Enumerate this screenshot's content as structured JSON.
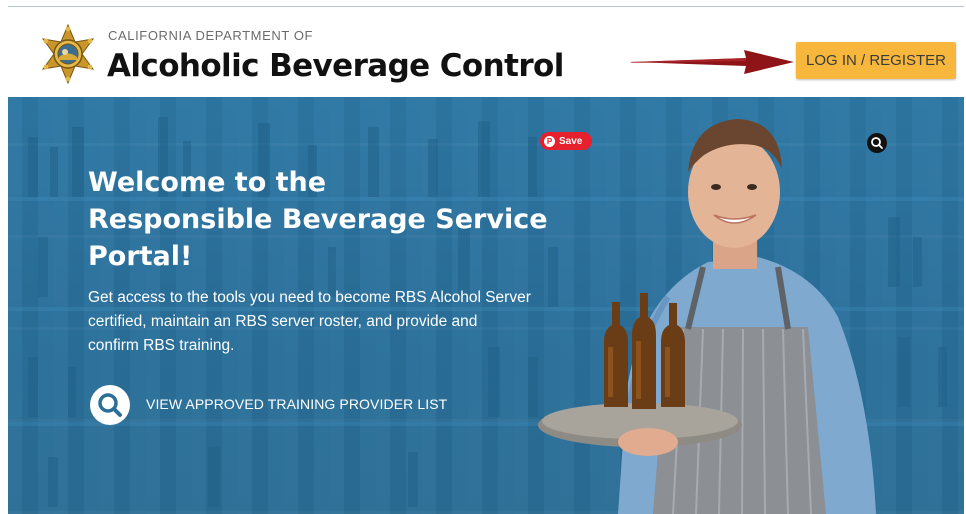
{
  "header": {
    "department": "CALIFORNIA DEPARTMENT OF",
    "brand": "Alcoholic Beverage Control",
    "login_label": "LOG IN / REGISTER"
  },
  "hero": {
    "title_lines": [
      "Welcome to the",
      "Responsible Beverage Service",
      "Portal!"
    ],
    "description_lines": [
      "Get access to the tools you need to become RBS Alcohol Server",
      "certified, maintain an RBS server roster, and provide and",
      "confirm RBS training."
    ],
    "view_link": "VIEW APPROVED TRAINING PROVIDER LIST"
  },
  "overlays": {
    "pinterest_label": "Save"
  },
  "colors": {
    "hero_blue": "#2f7aa6",
    "login_button": "#f6b73c",
    "arrow": "#8e1418",
    "pin_red": "#e6202d"
  },
  "icons": [
    "california-seal-icon",
    "red-arrow-icon",
    "search-icon",
    "pinterest-icon",
    "lens-search-icon"
  ]
}
